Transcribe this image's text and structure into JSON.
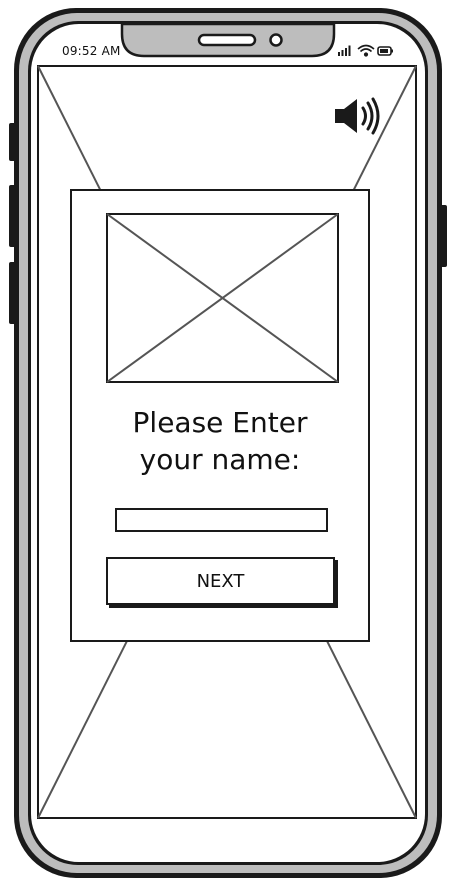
{
  "status_bar": {
    "time": "09:52 AM",
    "icons": [
      "signal-icon",
      "wifi-icon",
      "battery-icon"
    ]
  },
  "screen": {
    "background_placeholder": "image-placeholder",
    "sound_icon": "speaker-icon"
  },
  "dialog": {
    "image_placeholder": "image-placeholder",
    "title": "Please Enter\nyour name:",
    "name_input": {
      "value": "",
      "placeholder": ""
    },
    "next_label": "NEXT"
  },
  "colors": {
    "stroke": "#1a1a1a",
    "phone_body": "#bdbdbd",
    "screen": "#ffffff"
  }
}
